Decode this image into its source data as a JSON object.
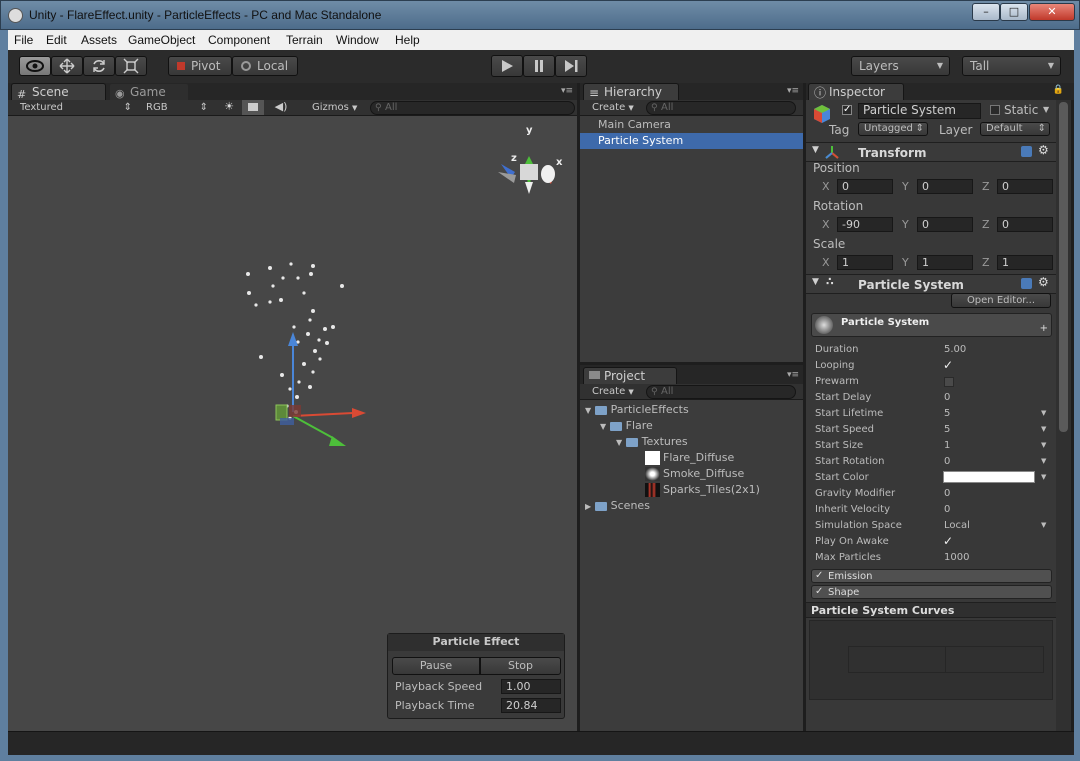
{
  "window": {
    "title": "Unity - FlareEffect.unity - ParticleEffects - PC and Mac Standalone"
  },
  "menu": [
    "File",
    "Edit",
    "Assets",
    "GameObject",
    "Component",
    "Terrain",
    "Window",
    "Help"
  ],
  "toolbar": {
    "pivot": "Pivot",
    "local": "Local",
    "layers": "Layers",
    "layout": "Tall"
  },
  "scene": {
    "tabs": [
      "Scene",
      "Game"
    ],
    "render_mode": "Textured",
    "color_mode": "RGB",
    "gizmos": "Gizmos",
    "search_placeholder": "All",
    "gizmo_axes": {
      "x": "x",
      "y": "y",
      "z": "z"
    },
    "particle_effect": {
      "title": "Particle Effect",
      "pause": "Pause",
      "stop": "Stop",
      "playback_speed_label": "Playback Speed",
      "playback_speed": "1.00",
      "playback_time_label": "Playback Time",
      "playback_time": "20.84"
    }
  },
  "hierarchy": {
    "tab": "Hierarchy",
    "create": "Create",
    "search": "All",
    "items": [
      "Main Camera",
      "Particle System"
    ]
  },
  "project": {
    "tab": "Project",
    "create": "Create",
    "search": "All",
    "tree": [
      {
        "label": "ParticleEffects"
      },
      {
        "label": "Flare"
      },
      {
        "label": "Textures"
      },
      {
        "label": "Flare_Diffuse"
      },
      {
        "label": "Smoke_Diffuse"
      },
      {
        "label": "Sparks_Tiles(2x1)"
      },
      {
        "label": "Scenes"
      }
    ]
  },
  "inspector": {
    "tab": "Inspector",
    "object_name": "Particle System",
    "static": "Static",
    "tag_label": "Tag",
    "tag": "Untagged",
    "layer_label": "Layer",
    "layer": "Default",
    "transform": {
      "title": "Transform",
      "position": "Position",
      "rotation": "Rotation",
      "scale": "Scale",
      "x": "X",
      "y": "Y",
      "z": "Z",
      "pos": [
        "0",
        "0",
        "0"
      ],
      "rot": [
        "-90",
        "0",
        "0"
      ],
      "scl": [
        "1",
        "1",
        "1"
      ]
    },
    "ps": {
      "title": "Particle System",
      "open_editor": "Open Editor...",
      "module_title": "Particle System",
      "rows": [
        {
          "label": "Duration",
          "value": "5.00"
        },
        {
          "label": "Looping",
          "value": ""
        },
        {
          "label": "Prewarm",
          "value": ""
        },
        {
          "label": "Start Delay",
          "value": "0"
        },
        {
          "label": "Start Lifetime",
          "value": "5"
        },
        {
          "label": "Start Speed",
          "value": "5"
        },
        {
          "label": "Start Size",
          "value": "1"
        },
        {
          "label": "Start Rotation",
          "value": "0"
        },
        {
          "label": "Start Color",
          "value": ""
        },
        {
          "label": "Gravity Modifier",
          "value": "0"
        },
        {
          "label": "Inherit Velocity",
          "value": "0"
        },
        {
          "label": "Simulation Space",
          "value": "Local"
        },
        {
          "label": "Play On Awake",
          "value": ""
        },
        {
          "label": "Max Particles",
          "value": "1000"
        }
      ],
      "emission": "Emission",
      "shape": "Shape",
      "curves": "Particle System Curves"
    }
  },
  "colors": {
    "selection": "#3e6aab",
    "accent_blue": "#4a86d8"
  }
}
